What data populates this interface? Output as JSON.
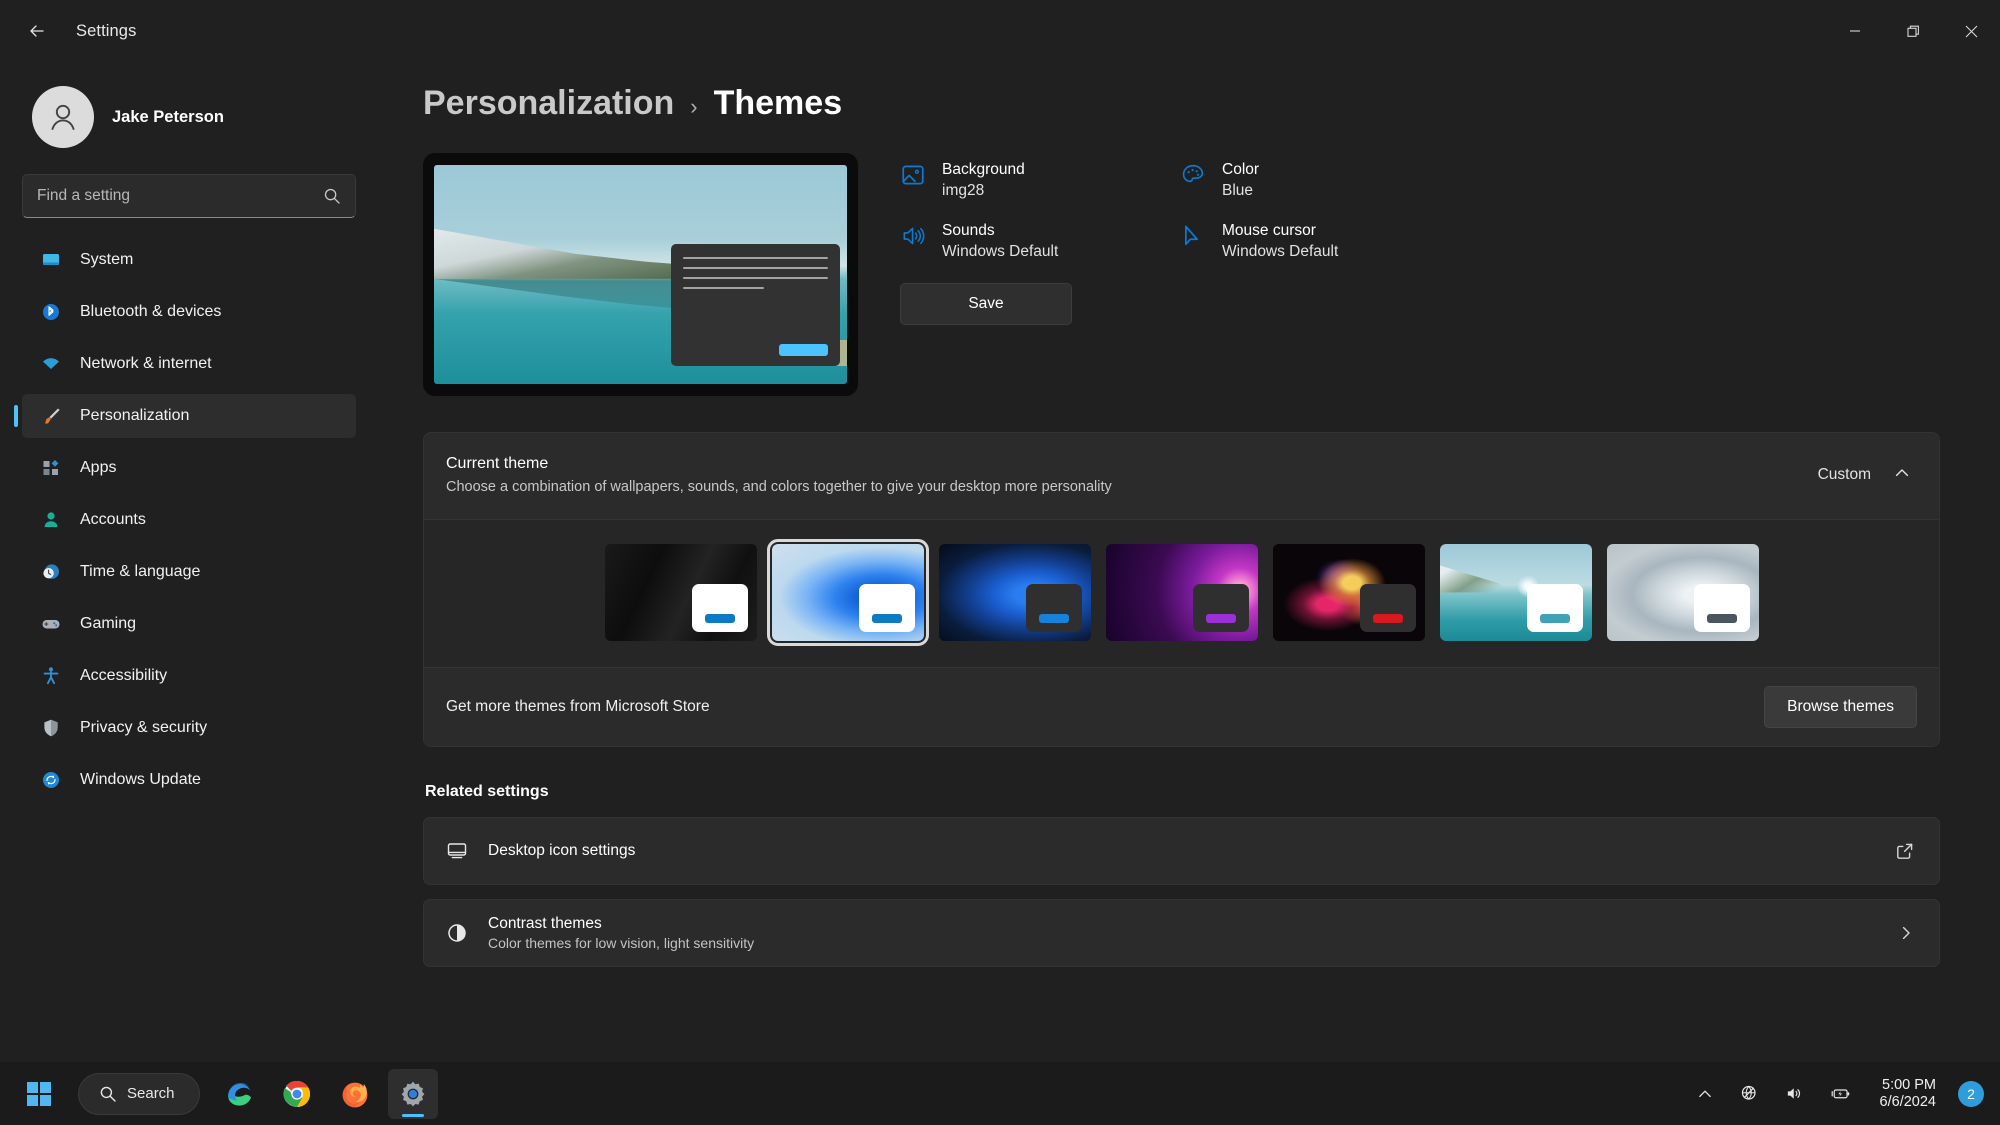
{
  "window": {
    "title": "Settings",
    "back_icon": "back-arrow-icon",
    "minimize_label": "Minimize",
    "restore_label": "Restore",
    "close_label": "Close"
  },
  "sidebar": {
    "profile_name": "Jake Peterson",
    "search_placeholder": "Find a setting",
    "search_value": "",
    "items": [
      {
        "label": "System",
        "icon": "monitor-icon",
        "selected": false
      },
      {
        "label": "Bluetooth & devices",
        "icon": "bluetooth-icon",
        "selected": false
      },
      {
        "label": "Network & internet",
        "icon": "wifi-icon",
        "selected": false
      },
      {
        "label": "Personalization",
        "icon": "paintbrush-icon",
        "selected": true
      },
      {
        "label": "Apps",
        "icon": "apps-icon",
        "selected": false
      },
      {
        "label": "Accounts",
        "icon": "person-icon",
        "selected": false
      },
      {
        "label": "Time & language",
        "icon": "clock-globe-icon",
        "selected": false
      },
      {
        "label": "Gaming",
        "icon": "gamepad-icon",
        "selected": false
      },
      {
        "label": "Accessibility",
        "icon": "accessibility-icon",
        "selected": false
      },
      {
        "label": "Privacy & security",
        "icon": "shield-icon",
        "selected": false
      },
      {
        "label": "Windows Update",
        "icon": "update-icon",
        "selected": false
      }
    ]
  },
  "breadcrumb": {
    "parent": "Personalization",
    "separator": "›",
    "current": "Themes"
  },
  "theme_properties": {
    "save_label": "Save",
    "items": [
      {
        "name": "Background",
        "value": "img28",
        "icon": "image-icon"
      },
      {
        "name": "Color",
        "value": "Blue",
        "icon": "palette-icon"
      },
      {
        "name": "Sounds",
        "value": "Windows Default",
        "icon": "speaker-icon"
      },
      {
        "name": "Mouse cursor",
        "value": "Windows Default",
        "icon": "cursor-icon"
      }
    ]
  },
  "current_theme": {
    "title": "Current theme",
    "subtitle": "Choose a combination of wallpapers, sounds, and colors together to give your desktop more personality",
    "selected_value": "Custom",
    "expander_icon": "chevron-up-icon",
    "tiles": [
      {
        "name": "windows-dark",
        "selected": false,
        "accent": "#0d7ac4",
        "win_bg": "#ffffff"
      },
      {
        "name": "windows-light",
        "selected": true,
        "accent": "#0d7ac4",
        "win_bg": "#ffffff"
      },
      {
        "name": "windows-dark-blue",
        "selected": false,
        "accent": "#1683d8",
        "win_bg": "#2f2f2f"
      },
      {
        "name": "glow",
        "selected": false,
        "accent": "#9b30d9",
        "win_bg": "#2f2f2f"
      },
      {
        "name": "captured-motion",
        "selected": false,
        "accent": "#d71920",
        "win_bg": "#2f2f2f"
      },
      {
        "name": "sunrise",
        "selected": false,
        "accent": "#3fa3b5",
        "win_bg": "#ffffff"
      },
      {
        "name": "flow",
        "selected": false,
        "accent": "#4a5560",
        "win_bg": "#ffffff"
      }
    ],
    "footer_text": "Get more themes from Microsoft Store",
    "browse_label": "Browse themes"
  },
  "related": {
    "title": "Related settings",
    "rows": [
      {
        "title": "Desktop icon settings",
        "subtitle": "",
        "icon": "desktop-icon",
        "end_icon": "external-link-icon"
      },
      {
        "title": "Contrast themes",
        "subtitle": "Color themes for low vision, light sensitivity",
        "icon": "contrast-icon",
        "end_icon": "chevron-right-icon"
      }
    ]
  },
  "taskbar": {
    "start_label": "Start",
    "search_label": "Search",
    "search_icon": "search-icon",
    "apps": [
      {
        "name": "Microsoft Edge",
        "icon": "edge-icon",
        "active": false
      },
      {
        "name": "Google Chrome",
        "icon": "chrome-icon",
        "active": false
      },
      {
        "name": "Firefox",
        "icon": "firefox-icon",
        "active": false
      },
      {
        "name": "Settings",
        "icon": "settings-gear-icon",
        "active": true
      }
    ],
    "tray": {
      "overflow_icon": "chevron-up-icon",
      "network_icon": "globe-no-internet-icon",
      "volume_icon": "volume-icon",
      "battery_icon": "battery-charging-icon",
      "time": "5:00 PM",
      "date": "6/6/2024",
      "notification_count": "2"
    }
  },
  "colors": {
    "accent": "#4cc2ff",
    "window_bg": "#202020",
    "card_bg": "#2b2b2b",
    "taskbar_bg": "#1b1b1b",
    "badge": "#2f9ddb"
  }
}
